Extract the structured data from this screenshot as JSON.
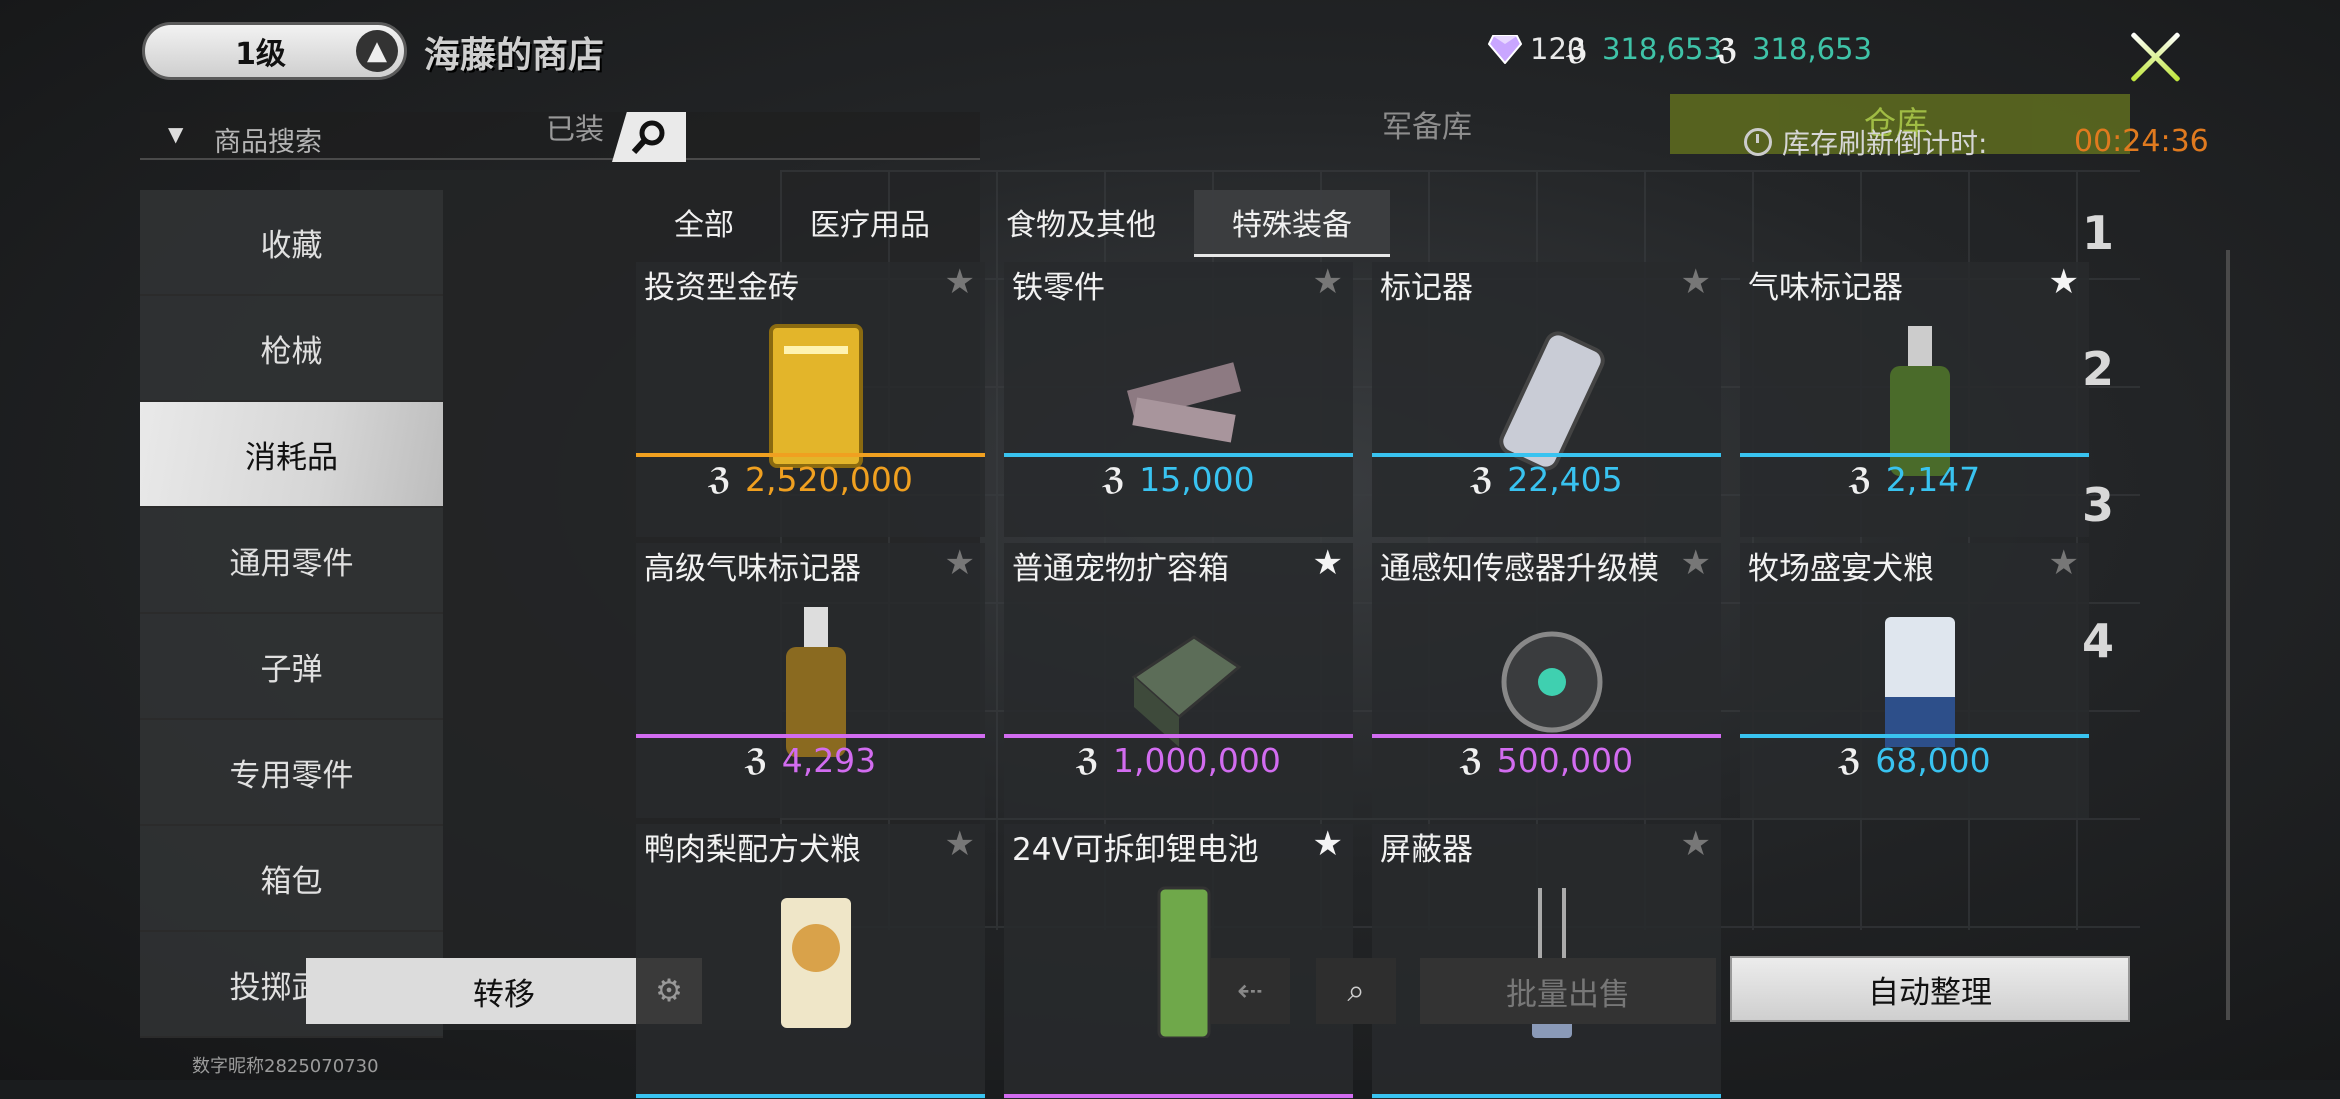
{
  "header": {
    "level": "1级",
    "shop_title": "海藤的商店",
    "diamond_count": "120",
    "coin_count_1": "318,653",
    "coin_count_2": "318,653"
  },
  "search": {
    "placeholder": "商品搜索",
    "faded_label": "已装"
  },
  "sub_tabs": {
    "armory": "军备库",
    "warehouse": "仓库",
    "refresh_label": "库存刷新倒计时:",
    "refresh_timer": "00:24:36"
  },
  "categories": [
    "收藏",
    "枪械",
    "消耗品",
    "通用零件",
    "子弹",
    "专用零件",
    "箱包",
    "投掷武器"
  ],
  "active_category": "消耗品",
  "filter_tabs": [
    "全部",
    "医疗用品",
    "食物及其他",
    "特殊装备"
  ],
  "active_filter": "特殊装备",
  "coin_glyph": "ℨ",
  "items": [
    {
      "name": "投资型金砖",
      "price": "2,520,000",
      "price_color": "#f0a020",
      "bar_color": "#f0a020",
      "favorited": false,
      "icon": "gold-bar-icon"
    },
    {
      "name": "铁零件",
      "price": "15,000",
      "price_color": "#39c3f0",
      "bar_color": "#39c3f0",
      "favorited": false,
      "icon": "iron-parts-icon"
    },
    {
      "name": "标记器",
      "price": "22,405",
      "price_color": "#39c3f0",
      "bar_color": "#39c3f0",
      "favorited": false,
      "icon": "marker-device-icon"
    },
    {
      "name": "气味标记器",
      "price": "2,147",
      "price_color": "#39c3f0",
      "bar_color": "#39c3f0",
      "favorited": true,
      "icon": "scent-spray-icon"
    },
    {
      "name": "高级气味标记器",
      "price": "4,293",
      "price_color": "#d26cf0",
      "bar_color": "#d26cf0",
      "favorited": false,
      "icon": "advanced-scent-spray-icon"
    },
    {
      "name": "普通宠物扩容箱",
      "price": "1,000,000",
      "price_color": "#d26cf0",
      "bar_color": "#d26cf0",
      "favorited": true,
      "icon": "pet-box-icon"
    },
    {
      "name": "通感知传感器升级模",
      "price": "500,000",
      "price_color": "#d26cf0",
      "bar_color": "#d26cf0",
      "favorited": false,
      "icon": "sensor-module-icon"
    },
    {
      "name": "牧场盛宴犬粮",
      "price": "68,000",
      "price_color": "#39c3f0",
      "bar_color": "#39c3f0",
      "favorited": false,
      "icon": "dog-food-bag-icon"
    },
    {
      "name": "鸭肉梨配方犬粮",
      "price": "",
      "price_color": "#39c3f0",
      "bar_color": "#39c3f0",
      "favorited": false,
      "icon": "duck-dog-food-icon"
    },
    {
      "name": "24V可拆卸锂电池",
      "price": "",
      "price_color": "#d26cf0",
      "bar_color": "#d26cf0",
      "favorited": true,
      "icon": "battery-icon"
    },
    {
      "name": "屏蔽器",
      "price": "",
      "price_color": "#39c3f0",
      "bar_color": "#39c3f0",
      "favorited": false,
      "icon": "jammer-icon"
    }
  ],
  "row_numbers": [
    "1",
    "2",
    "3",
    "4"
  ],
  "bottom": {
    "transfer": "转移",
    "batch_sell": "批量出售",
    "auto_sort": "自动整理"
  },
  "footer_id": "数字昵称2825070730"
}
